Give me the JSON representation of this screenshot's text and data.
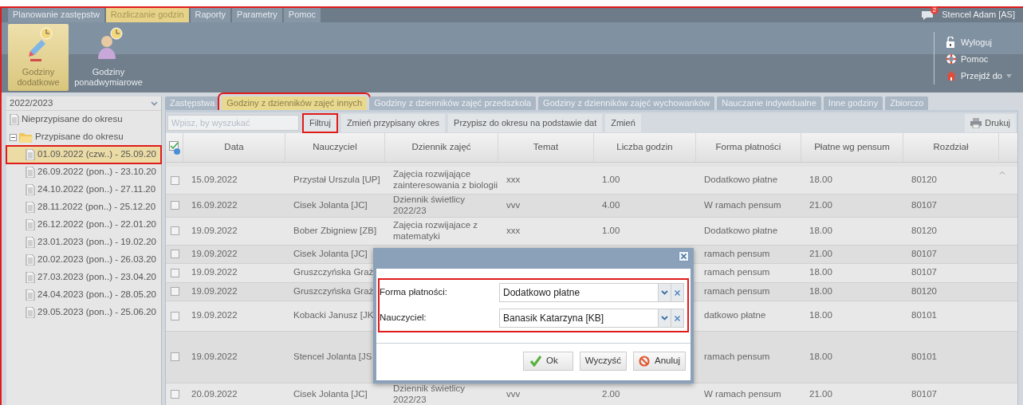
{
  "menu_tabs": [
    {
      "label": "Planowanie zastępstw",
      "selected": false
    },
    {
      "label": "Rozliczanie godzin",
      "selected": true
    },
    {
      "label": "Raporty",
      "selected": false
    },
    {
      "label": "Parametry",
      "selected": false
    },
    {
      "label": "Pomoc",
      "selected": false
    }
  ],
  "ribbon": [
    {
      "label": "Godziny dodatkowe",
      "selected": true
    },
    {
      "label": "Godziny ponadwymiarowe",
      "selected": false
    }
  ],
  "user": {
    "notifications": "2",
    "name": "Stencel Adam [AS]"
  },
  "user_menu": [
    {
      "label": "Wyloguj",
      "kind": "logout"
    },
    {
      "label": "Pomoc",
      "kind": "help"
    },
    {
      "label": "Przejdź do",
      "kind": "goto"
    }
  ],
  "sidebar": {
    "year": "2022/2023",
    "tree": [
      {
        "label": "Nieprzypisane do okresu",
        "kind": "doc"
      },
      {
        "label": "Przypisane do okresu",
        "kind": "folder",
        "expanded": true,
        "children": [
          {
            "label": "01.09.2022 (czw..) - 25.09.20",
            "selected": true,
            "highlighted": true
          },
          {
            "label": "26.09.2022 (pon..) - 23.10.20",
            "selected": false,
            "highlighted": false
          },
          {
            "label": "24.10.2022 (pon..) - 27.11.20",
            "selected": false,
            "highlighted": false
          },
          {
            "label": "28.11.2022 (pon..) - 25.12.20",
            "selected": false,
            "highlighted": false
          },
          {
            "label": "26.12.2022 (pon..) - 22.01.20",
            "selected": false,
            "highlighted": false
          },
          {
            "label": "23.01.2023 (pon..) - 19.02.20",
            "selected": false,
            "highlighted": false
          },
          {
            "label": "20.02.2023 (pon..) - 26.03.20",
            "selected": false,
            "highlighted": false
          },
          {
            "label": "27.03.2023 (pon..) - 23.04.20",
            "selected": false,
            "highlighted": false
          },
          {
            "label": "24.04.2023 (pon..) - 28.05.20",
            "selected": false,
            "highlighted": false
          },
          {
            "label": "29.05.2023 (pon..) - 25.06.20",
            "selected": false,
            "highlighted": false
          }
        ]
      }
    ]
  },
  "content_tabs": [
    {
      "label": "Zastępstwa",
      "selected": false,
      "highlighted": false
    },
    {
      "label": "Godziny z dzienników zajęć innych",
      "selected": true,
      "highlighted": true
    },
    {
      "label": "Godziny z dzienników zajęć przedszkola",
      "selected": false,
      "highlighted": false
    },
    {
      "label": "Godziny z dzienników zajęć wychowanków",
      "selected": false,
      "highlighted": false
    },
    {
      "label": "Nauczanie indywidualne",
      "selected": false,
      "highlighted": false
    },
    {
      "label": "Inne godziny",
      "selected": false,
      "highlighted": false
    },
    {
      "label": "Zbiorczo",
      "selected": false,
      "highlighted": false
    }
  ],
  "toolbar": {
    "search_placeholder": "Wpisz, by wyszukać",
    "buttons": [
      {
        "label": "Filtruj",
        "highlighted": true
      },
      {
        "label": "Zmień przypisany okres",
        "highlighted": false
      },
      {
        "label": "Przypisz do okresu na podstawie dat",
        "highlighted": false
      },
      {
        "label": "Zmień",
        "highlighted": false
      }
    ],
    "print": "Drukuj"
  },
  "table": {
    "columns": [
      "Data",
      "Nauczyciel",
      "Dziennik zajęć",
      "Temat",
      "Liczba godzin",
      "Forma płatności",
      "Płatne wg pensum",
      "Rozdział"
    ],
    "rows": [
      {
        "checked": false,
        "cells": [
          "15.09.2022",
          "Przystał Urszula [UP]",
          "Zajęcia rozwijające zainteresowania z biologii",
          "xxx",
          "1.00",
          "Dodatkowo płatne",
          "18.00",
          "80120"
        ]
      },
      {
        "checked": false,
        "cells": [
          "16.09.2022",
          "Cisek Jolanta [JC]",
          "Dziennik świetlicy 2022/23",
          "vvv",
          "4.00",
          "W ramach pensum",
          "21.00",
          "80107"
        ]
      },
      {
        "checked": false,
        "cells": [
          "19.09.2022",
          "Bober Zbigniew [ZB]",
          "Zajęcia rozwijajace z matematyki",
          "xxx",
          "1.00",
          "Dodatkowo płatne",
          "18.00",
          "80120"
        ]
      },
      {
        "checked": false,
        "cells": [
          "19.09.2022",
          "Cisek Jolanta [JC]",
          null,
          null,
          null,
          "ramach pensum",
          "21.00",
          "80107"
        ]
      },
      {
        "checked": false,
        "cells": [
          "19.09.2022",
          "Gruszczyńska Graż",
          null,
          null,
          null,
          "ramach pensum",
          "18.00",
          "80107"
        ]
      },
      {
        "checked": false,
        "cells": [
          "19.09.2022",
          "Gruszczyńska Graż",
          null,
          null,
          null,
          "ramach pensum",
          "18.00",
          "80120"
        ]
      },
      {
        "checked": false,
        "cells": [
          "19.09.2022",
          "Kobacki Janusz [JK",
          null,
          null,
          null,
          "datkowo płatne",
          "18.00",
          "80101"
        ]
      },
      {
        "checked": false,
        "cells": [
          "19.09.2022",
          "Stencel Jolanta [JS",
          null,
          null,
          null,
          "ramach pensum",
          "18.00",
          "80101"
        ]
      },
      {
        "checked": false,
        "cells": [
          "20.09.2022",
          "Cisek Jolanta [JC]",
          "Dziennik świetlicy 2022/23",
          "vvv",
          "2.00",
          "W ramach pensum",
          "21.00",
          "80107"
        ]
      }
    ]
  },
  "dialog": {
    "highlighted": true,
    "fields": [
      {
        "label": "Forma płatności:",
        "value": "Dodatkowo płatne"
      },
      {
        "label": "Nauczyciel:",
        "value": "Banasik Katarzyna [KB]"
      }
    ],
    "buttons": [
      {
        "label": "Ok",
        "kind": "ok"
      },
      {
        "label": "Wyczyść",
        "kind": "clear"
      },
      {
        "label": "Anuluj",
        "kind": "cancel"
      }
    ]
  }
}
